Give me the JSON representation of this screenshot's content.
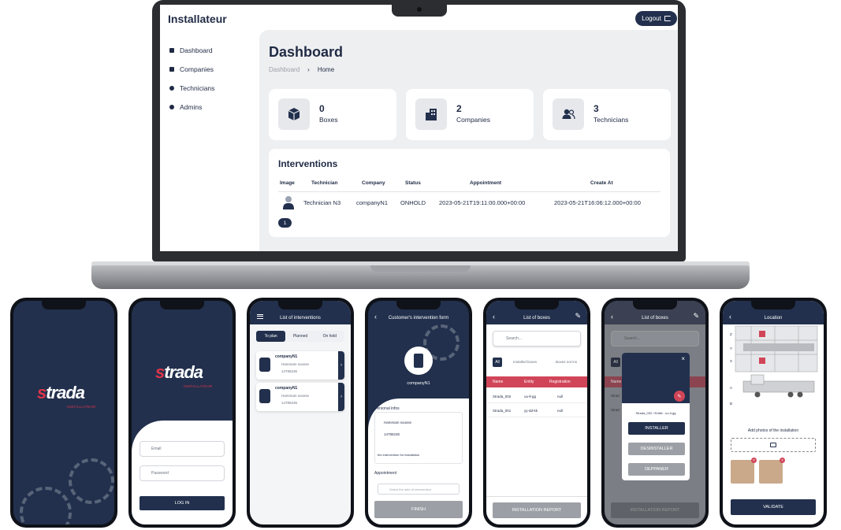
{
  "laptop": {
    "app_title": "Installateur",
    "logout_label": "Logout",
    "nav": [
      {
        "label": "Dashboard"
      },
      {
        "label": "Companies"
      },
      {
        "label": "Technicians"
      },
      {
        "label": "Admins"
      }
    ],
    "page_title": "Dashboard",
    "breadcrumb": {
      "root": "Dashboard",
      "separator": "›",
      "current": "Home"
    },
    "stats": [
      {
        "value": "0",
        "label": "Boxes",
        "icon": "box-icon"
      },
      {
        "value": "2",
        "label": "Companies",
        "icon": "building-icon"
      },
      {
        "value": "3",
        "label": "Technicians",
        "icon": "users-icon"
      }
    ],
    "interventions": {
      "title": "Interventions",
      "columns": [
        "Image",
        "Technician",
        "Company",
        "Status",
        "Appointment",
        "Create At"
      ],
      "rows": [
        {
          "technician": "Technician N3",
          "company": "companyN1",
          "status": "ONHOLD",
          "appointment": "2023-05-21T19:11:00.000+00:00",
          "created_at": "2023-05-21T16:06:12.000+00:00"
        }
      ],
      "page": "1"
    }
  },
  "phones": {
    "splash": {
      "logo": "trada",
      "logo_mark": "s",
      "subtitle": "INSTALLATEUR"
    },
    "login": {
      "logo": "trada",
      "logo_mark": "s",
      "subtitle": "INSTALLATEUR",
      "email_placeholder": "Email",
      "password_placeholder": "Password",
      "login_label": "LOG IN"
    },
    "interventions": {
      "title": "List of interventions",
      "tabs": [
        "To plan",
        "Planned",
        "On hold"
      ],
      "items": [
        {
          "name": "companyN1",
          "address": "Hammam sousse",
          "phone": "14785236"
        },
        {
          "name": "companyN1",
          "address": "Hammam sousse",
          "phone": "14785236"
        }
      ]
    },
    "form": {
      "title": "Customer's intervention form",
      "company": "companyN1",
      "personal_title": "Personal infos",
      "address": "Hammam sousse",
      "phone": "14785236",
      "note": "the intervention for installation",
      "appointment_title": "Appointment",
      "date_placeholder": "Select the date of intervention",
      "finish_label": "FINISH"
    },
    "boxes": {
      "title": "List of boxes",
      "search_placeholder": "Search...",
      "filters": [
        "All",
        "Installed boxes",
        "Boxes not ins"
      ],
      "columns": [
        "Name",
        "Entity",
        "Registration"
      ],
      "rows": [
        {
          "name": "Strada_002",
          "entity": "uu-ll-gg",
          "registration": "null"
        },
        {
          "name": "Strada_001",
          "entity": "yy-dd-kk",
          "registration": "null"
        }
      ],
      "report_label": "INSTALLATION REPORT"
    },
    "boxes_modal": {
      "title": "List of boxes",
      "search_placeholder": "Search...",
      "filter_all": "All",
      "column_name": "Name",
      "row1": "Strad",
      "row2": "Strad",
      "modal_caption": "Strada_002 / Entité : uu-ll-gg",
      "actions": [
        "INSTALLER",
        "DESINSTALLER",
        "DEPPANER"
      ],
      "report_label": "INSTALLATION REPORT"
    },
    "location": {
      "title": "Location",
      "axis_labels": [
        "Z",
        "Y",
        "X",
        "A",
        "B"
      ],
      "photos_label": "Add photos of the installation",
      "validate_label": "VALIDATE"
    }
  }
}
